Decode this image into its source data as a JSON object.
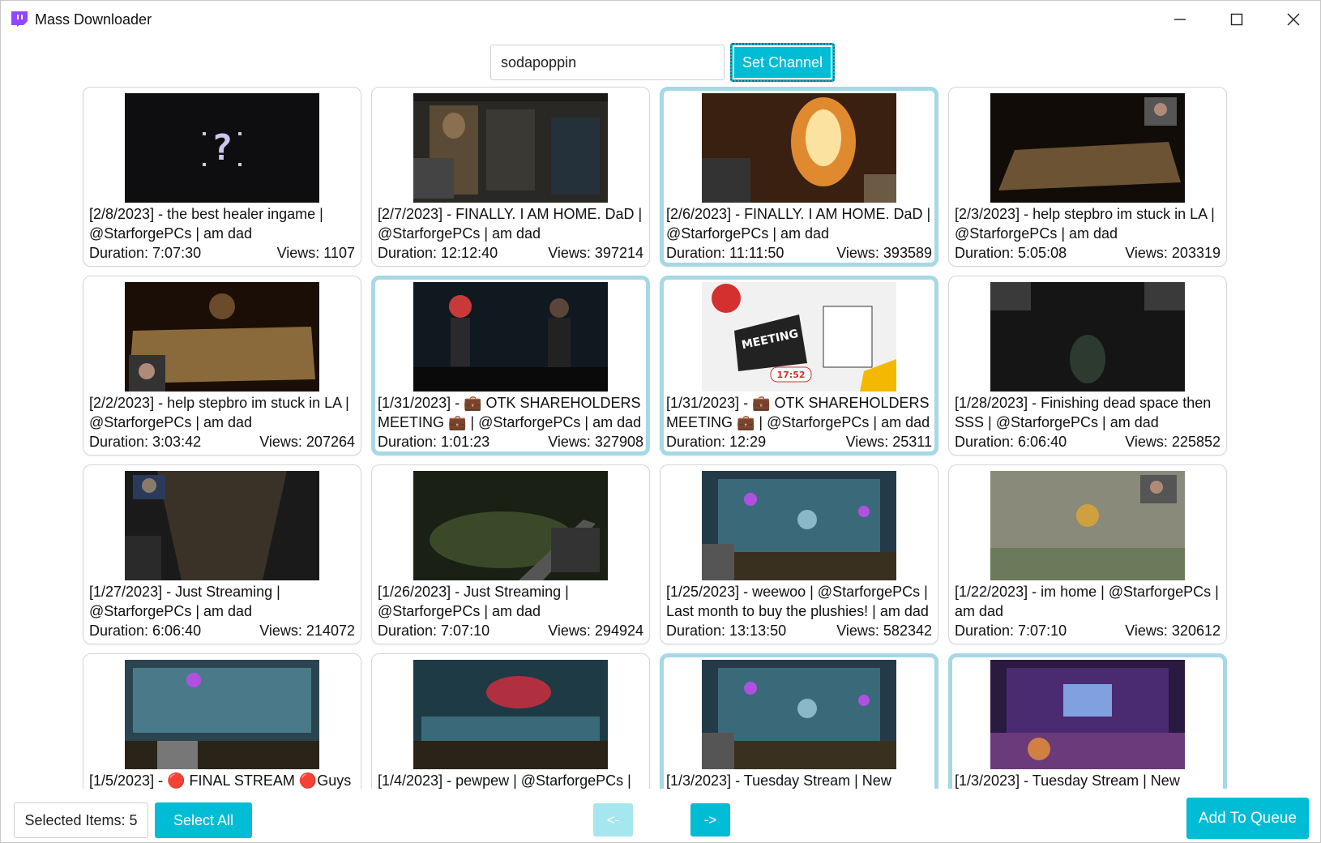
{
  "window": {
    "title": "Mass Downloader",
    "minimize_glyph": "—",
    "maximize_glyph": "☐",
    "close_glyph": "✕"
  },
  "channel": {
    "value": "sodapoppin",
    "button_label": "Set Channel"
  },
  "videos": [
    {
      "title": "[2/8/2023] - the best healer ingame  | @StarforgePCs | am dad",
      "duration": "Duration: 7:07:30",
      "views": "Views: 1107",
      "selected": false,
      "thumb": "question"
    },
    {
      "title": "[2/7/2023] - FINALLY. I AM HOME. DaD  | @StarforgePCs | am dad",
      "duration": "Duration: 12:12:40",
      "views": "Views: 397214",
      "selected": false,
      "thumb": "inventory"
    },
    {
      "title": "[2/6/2023] - FINALLY. I AM HOME. DaD  | @StarforgePCs | am dad",
      "duration": "Duration: 11:11:50",
      "views": "Views: 393589",
      "selected": true,
      "thumb": "fire"
    },
    {
      "title": "[2/3/2023] - help stepbro im stuck in LA | @StarforgePCs | am dad",
      "duration": "Duration: 5:05:08",
      "views": "Views: 203319",
      "selected": false,
      "thumb": "board"
    },
    {
      "title": "[2/2/2023] - help stepbro im stuck in LA | @StarforgePCs | am dad",
      "duration": "Duration: 3:03:42",
      "views": "Views: 207264",
      "selected": false,
      "thumb": "board2"
    },
    {
      "title": "[1/31/2023] - 💼 OTK SHAREHOLDERS MEETING 💼 | @StarforgePCs | am dad",
      "duration": "Duration: 1:01:23",
      "views": "Views: 327908",
      "selected": true,
      "thumb": "stage"
    },
    {
      "title": "[1/31/2023] - 💼 OTK SHAREHOLDERS MEETING 💼 | @StarforgePCs | am dad",
      "duration": "Duration: 12:29",
      "views": "Views: 25311",
      "selected": true,
      "thumb": "meeting"
    },
    {
      "title": "[1/28/2023] - Finishing dead space then SSS | @StarforgePCs | am dad",
      "duration": "Duration: 6:06:40",
      "views": "Views: 225852",
      "selected": false,
      "thumb": "deadspace"
    },
    {
      "title": "[1/27/2023] - Just Streaming | @StarforgePCs | am dad",
      "duration": "Duration: 6:06:40",
      "views": "Views: 214072",
      "selected": false,
      "thumb": "corridor"
    },
    {
      "title": "[1/26/2023] - Just Streaming | @StarforgePCs | am dad",
      "duration": "Duration: 7:07:10",
      "views": "Views: 294924",
      "selected": false,
      "thumb": "jungle"
    },
    {
      "title": "[1/25/2023] - weewoo | @StarforgePCs | Last month to buy the plushies! | am dad",
      "duration": "Duration: 13:13:50",
      "views": "Views: 582342",
      "selected": false,
      "thumb": "wc3"
    },
    {
      "title": "[1/22/2023] - im home | @StarforgePCs | am dad",
      "duration": "Duration: 7:07:10",
      "views": "Views: 320612",
      "selected": false,
      "thumb": "platformer"
    },
    {
      "title": "[1/5/2023] - 🔴 FINAL STREAM 🔴Guys",
      "duration": "",
      "views": "",
      "selected": false,
      "thumb": "wc3b"
    },
    {
      "title": "[1/4/2023] - pewpew | @StarforgePCs |",
      "duration": "",
      "views": "",
      "selected": false,
      "thumb": "wc3c"
    },
    {
      "title": "[1/3/2023] - Tuesday Stream | New",
      "duration": "",
      "views": "",
      "selected": true,
      "thumb": "wc3"
    },
    {
      "title": "[1/3/2023] - Tuesday Stream | New",
      "duration": "",
      "views": "",
      "selected": true,
      "thumb": "room"
    }
  ],
  "footer": {
    "selected_items": "Selected Items: 5",
    "select_all": "Select All",
    "prev": "<-",
    "next": "->",
    "add_to_queue": "Add To Queue"
  },
  "colors": {
    "accent": "#00bcd4",
    "accent_disabled": "#a6e6ef",
    "selected_border": "#a6d8e6",
    "app_icon": "#9146ff"
  }
}
